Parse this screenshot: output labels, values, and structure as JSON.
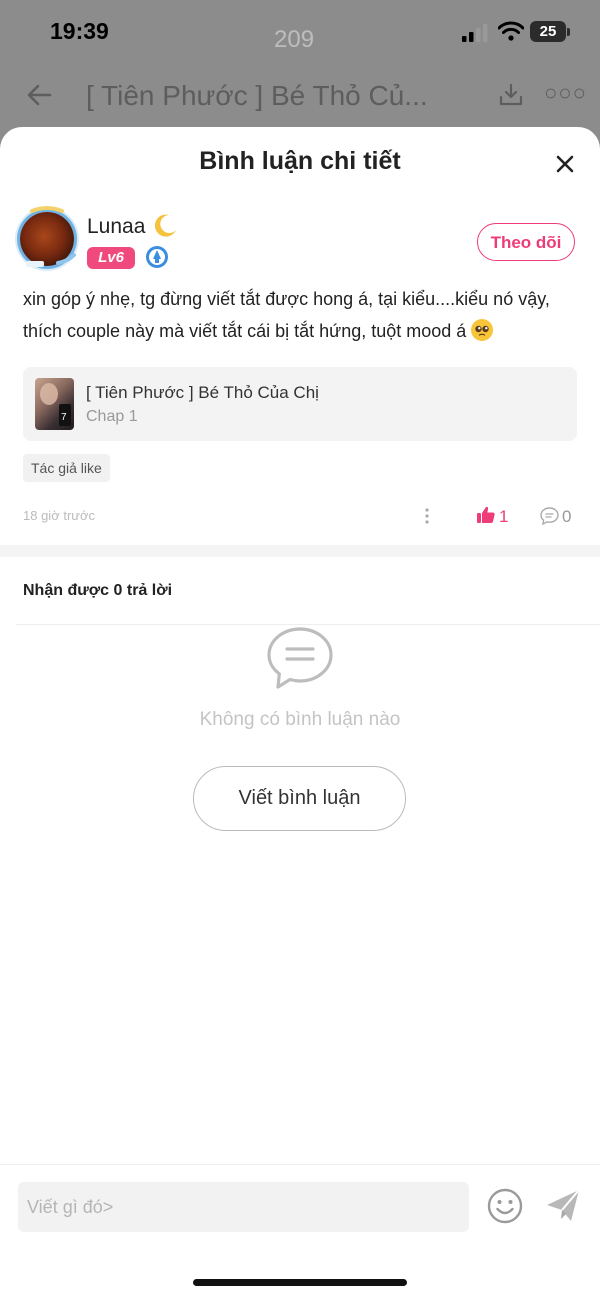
{
  "status_bar": {
    "time": "19:39",
    "battery": "25"
  },
  "background": {
    "title": "[ Tiên Phước ] Bé Thỏ Củ...",
    "count": "209"
  },
  "sheet": {
    "title": "Bình luận chi tiết"
  },
  "comment": {
    "username": "Lunaa",
    "level": "Lv6",
    "follow_label": "Theo dõi",
    "text": "xin góp ý nhẹ, tg đừng viết tắt được hong á, tại kiểu....kiểu nó vậy, thích couple này mà viết tắt cái bị tắt hứng, tuột mood á",
    "story_title": "[ Tiên Phước ] Bé Thỏ Của Chị",
    "story_chapter": "Chap 1",
    "tag": "Tác giả like",
    "time_ago": "18 giờ trước",
    "likes": "1",
    "replies": "0"
  },
  "replies_section": {
    "heading": "Nhận được 0 trả lời",
    "empty_text": "Không có bình luận nào",
    "write_button": "Viết bình luận"
  },
  "composer": {
    "placeholder": "Viết gì đó>"
  },
  "colors": {
    "accent": "#ee3c78",
    "level_badge": "#f0497e"
  }
}
